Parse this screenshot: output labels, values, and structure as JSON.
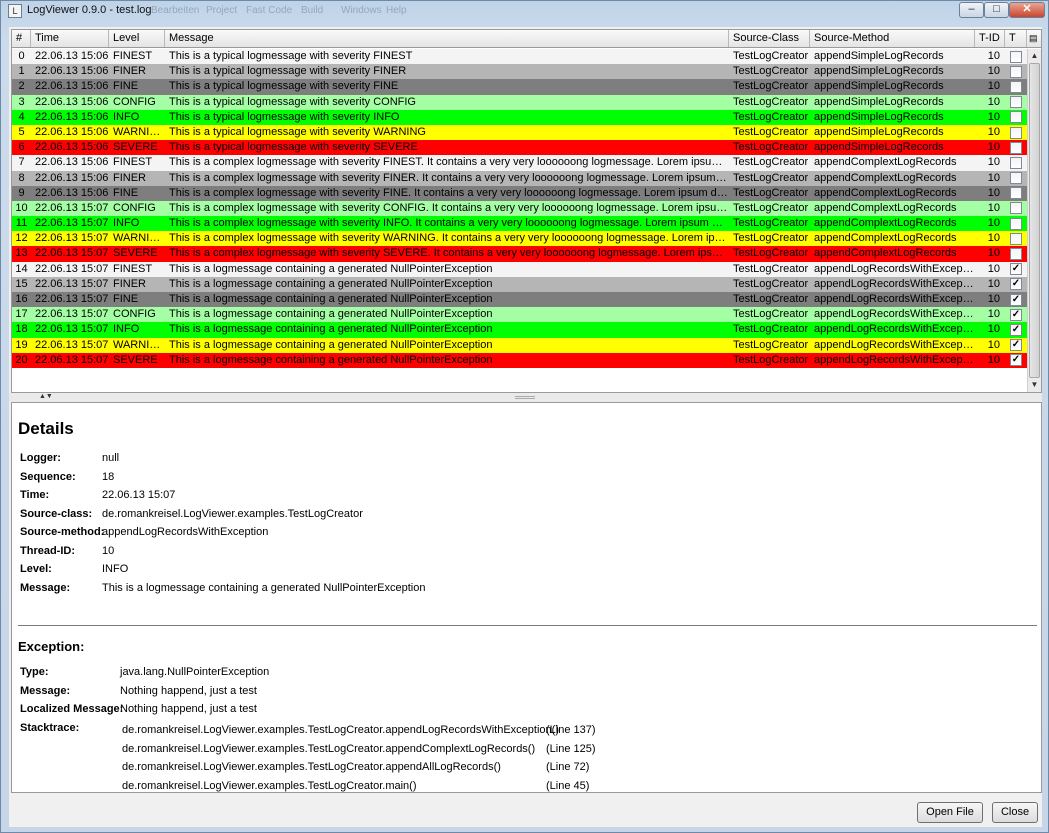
{
  "window": {
    "title": "LogViewer 0.9.0 - test.log",
    "menu_ghost": [
      "Bearbeiten",
      "Project",
      "Fast Code",
      "Build",
      "Windows",
      "Help"
    ],
    "minimize_glyph": "–",
    "maximize_glyph": "□",
    "close_glyph": "✕",
    "icon_glyph": "L"
  },
  "colors": {
    "FINEST": "#f4f4f4",
    "FINER": "#b5b5b5",
    "FINE": "#7e7e7e",
    "CONFIG": "#a4ffa4",
    "INFO": "#00ff00",
    "WARNING": "#ffff00",
    "SEVERE": "#ff0000"
  },
  "table": {
    "columns": [
      "#",
      "Time",
      "Level",
      "Message",
      "Source-Class",
      "Source-Method",
      "T-ID",
      "T"
    ],
    "rows": [
      {
        "num": "0",
        "time": "22.06.13 15:06",
        "level": "FINEST",
        "message": "This is a typical logmessage with severity FINEST",
        "source_class": "TestLogCreator",
        "source_method": "appendSimpleLogRecords",
        "tid": "10",
        "t": false
      },
      {
        "num": "1",
        "time": "22.06.13 15:06",
        "level": "FINER",
        "message": "This is a typical logmessage with severity FINER",
        "source_class": "TestLogCreator",
        "source_method": "appendSimpleLogRecords",
        "tid": "10",
        "t": false
      },
      {
        "num": "2",
        "time": "22.06.13 15:06",
        "level": "FINE",
        "message": "This is a typical logmessage with severity FINE",
        "source_class": "TestLogCreator",
        "source_method": "appendSimpleLogRecords",
        "tid": "10",
        "t": false
      },
      {
        "num": "3",
        "time": "22.06.13 15:06",
        "level": "CONFIG",
        "message": "This is a typical logmessage with severity CONFIG",
        "source_class": "TestLogCreator",
        "source_method": "appendSimpleLogRecords",
        "tid": "10",
        "t": false
      },
      {
        "num": "4",
        "time": "22.06.13 15:06",
        "level": "INFO",
        "message": "This is a typical logmessage with severity INFO",
        "source_class": "TestLogCreator",
        "source_method": "appendSimpleLogRecords",
        "tid": "10",
        "t": false
      },
      {
        "num": "5",
        "time": "22.06.13 15:06",
        "level": "WARNING",
        "message": "This is a typical logmessage with severity WARNING",
        "source_class": "TestLogCreator",
        "source_method": "appendSimpleLogRecords",
        "tid": "10",
        "t": false
      },
      {
        "num": "6",
        "time": "22.06.13 15:06",
        "level": "SEVERE",
        "message": "This is a typical logmessage with severity SEVERE",
        "source_class": "TestLogCreator",
        "source_method": "appendSimpleLogRecords",
        "tid": "10",
        "t": false
      },
      {
        "num": "7",
        "time": "22.06.13 15:06",
        "level": "FINEST",
        "message": "This is a complex logmessage with severity FINEST. It contains a very very loooooong logmessage. Lorem ipsum dolo...",
        "source_class": "TestLogCreator",
        "source_method": "appendComplextLogRecords",
        "tid": "10",
        "t": false
      },
      {
        "num": "8",
        "time": "22.06.13 15:06",
        "level": "FINER",
        "message": "This is a complex logmessage with severity FINER. It contains a very very loooooong logmessage. Lorem ipsum dolor ...",
        "source_class": "TestLogCreator",
        "source_method": "appendComplextLogRecords",
        "tid": "10",
        "t": false
      },
      {
        "num": "9",
        "time": "22.06.13 15:06",
        "level": "FINE",
        "message": "This is a complex logmessage with severity FINE. It contains a very very loooooong logmessage. Lorem ipsum dolor si...",
        "source_class": "TestLogCreator",
        "source_method": "appendComplextLogRecords",
        "tid": "10",
        "t": false
      },
      {
        "num": "10",
        "time": "22.06.13 15:07",
        "level": "CONFIG",
        "message": "This is a complex logmessage with severity CONFIG. It contains a very very loooooong logmessage. Lorem ipsum dol...",
        "source_class": "TestLogCreator",
        "source_method": "appendComplextLogRecords",
        "tid": "10",
        "t": false
      },
      {
        "num": "11",
        "time": "22.06.13 15:07",
        "level": "INFO",
        "message": "This is a complex logmessage with severity INFO. It contains a very very loooooong logmessage. Lorem ipsum dolor si...",
        "source_class": "TestLogCreator",
        "source_method": "appendComplextLogRecords",
        "tid": "10",
        "t": false
      },
      {
        "num": "12",
        "time": "22.06.13 15:07",
        "level": "WARNING",
        "message": "This is a complex logmessage with severity WARNING. It contains a very very loooooong logmessage. Lorem ipsum d...",
        "source_class": "TestLogCreator",
        "source_method": "appendComplextLogRecords",
        "tid": "10",
        "t": false
      },
      {
        "num": "13",
        "time": "22.06.13 15:07",
        "level": "SEVERE",
        "message": "This is a complex logmessage with severity SEVERE. It contains a very very loooooong logmessage. Lorem ipsum dol...",
        "source_class": "TestLogCreator",
        "source_method": "appendComplextLogRecords",
        "tid": "10",
        "t": false
      },
      {
        "num": "14",
        "time": "22.06.13 15:07",
        "level": "FINEST",
        "message": "This is a logmessage containing a generated NullPointerException",
        "source_class": "TestLogCreator",
        "source_method": "appendLogRecordsWithException",
        "tid": "10",
        "t": true
      },
      {
        "num": "15",
        "time": "22.06.13 15:07",
        "level": "FINER",
        "message": "This is a logmessage containing a generated NullPointerException",
        "source_class": "TestLogCreator",
        "source_method": "appendLogRecordsWithException",
        "tid": "10",
        "t": true
      },
      {
        "num": "16",
        "time": "22.06.13 15:07",
        "level": "FINE",
        "message": "This is a logmessage containing a generated NullPointerException",
        "source_class": "TestLogCreator",
        "source_method": "appendLogRecordsWithException",
        "tid": "10",
        "t": true
      },
      {
        "num": "17",
        "time": "22.06.13 15:07",
        "level": "CONFIG",
        "message": "This is a logmessage containing a generated NullPointerException",
        "source_class": "TestLogCreator",
        "source_method": "appendLogRecordsWithException",
        "tid": "10",
        "t": true
      },
      {
        "num": "18",
        "time": "22.06.13 15:07",
        "level": "INFO",
        "message": "This is a logmessage containing a generated NullPointerException",
        "source_class": "TestLogCreator",
        "source_method": "appendLogRecordsWithException",
        "tid": "10",
        "t": true
      },
      {
        "num": "19",
        "time": "22.06.13 15:07",
        "level": "WARNING",
        "message": "This is a logmessage containing a generated NullPointerException",
        "source_class": "TestLogCreator",
        "source_method": "appendLogRecordsWithException",
        "tid": "10",
        "t": true
      },
      {
        "num": "20",
        "time": "22.06.13 15:07",
        "level": "SEVERE",
        "message": "This is a logmessage containing a generated NullPointerException",
        "source_class": "TestLogCreator",
        "source_method": "appendLogRecordsWithException",
        "tid": "10",
        "t": true
      }
    ]
  },
  "details": {
    "title": "Details",
    "fields": [
      {
        "label": "Logger:",
        "value": "null"
      },
      {
        "label": "Sequence:",
        "value": "18"
      },
      {
        "label": "Time:",
        "value": "22.06.13 15:07"
      },
      {
        "label": "Source-class:",
        "value": "de.romankreisel.LogViewer.examples.TestLogCreator"
      },
      {
        "label": "Source-method:",
        "value": "appendLogRecordsWithException"
      },
      {
        "label": "Thread-ID:",
        "value": "10"
      },
      {
        "label": "Level:",
        "value": "INFO"
      },
      {
        "label": "Message:",
        "value": "This is a logmessage containing a generated NullPointerException"
      }
    ]
  },
  "exception": {
    "title": "Exception:",
    "fields": [
      {
        "label": "Type:",
        "value": "java.lang.NullPointerException"
      },
      {
        "label": "Message:",
        "value": "Nothing happend, just a test"
      },
      {
        "label": "Localized Message:",
        "value": "Nothing happend, just a test"
      }
    ],
    "stacktrace_label": "Stacktrace:",
    "stacktrace": [
      {
        "method": "de.romankreisel.LogViewer.examples.TestLogCreator.appendLogRecordsWithException()",
        "line": "(Line 137)"
      },
      {
        "method": "de.romankreisel.LogViewer.examples.TestLogCreator.appendComplextLogRecords()",
        "line": "(Line 125)"
      },
      {
        "method": "de.romankreisel.LogViewer.examples.TestLogCreator.appendAllLogRecords()",
        "line": "(Line 72)"
      },
      {
        "method": "de.romankreisel.LogViewer.examples.TestLogCreator.main()",
        "line": "(Line 45)"
      }
    ]
  },
  "buttons": {
    "open_file": "Open File",
    "close": "Close"
  },
  "splitter_arrows": "▲▼",
  "column_menu_icon": "▤"
}
